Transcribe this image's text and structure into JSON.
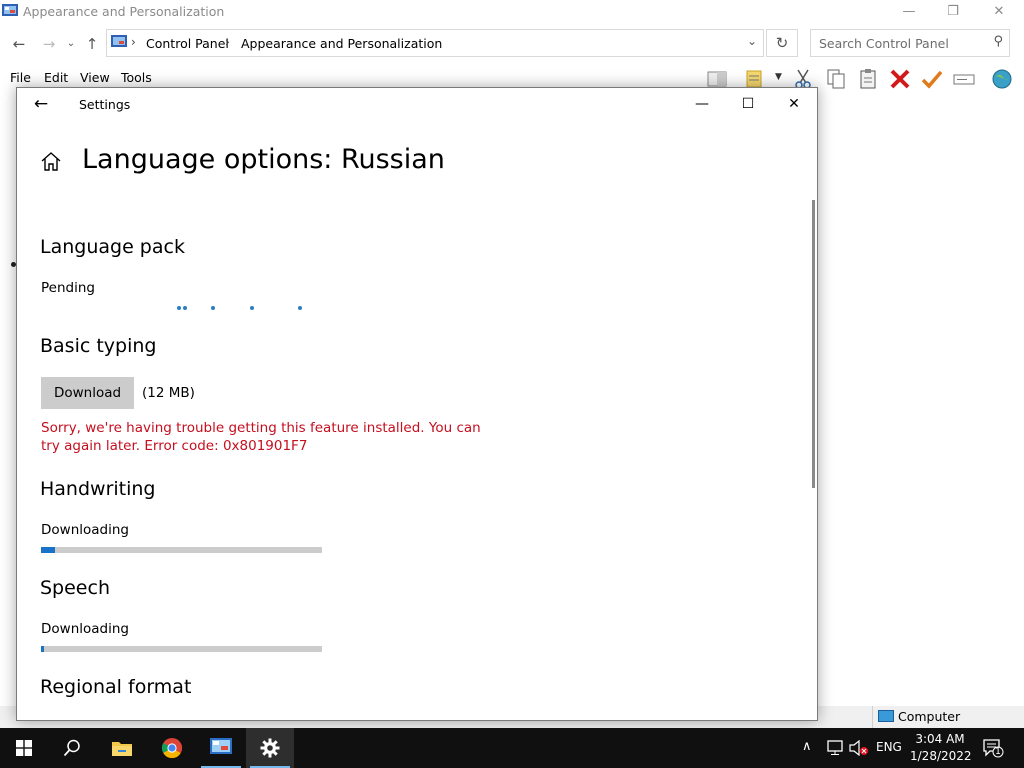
{
  "explorer": {
    "title": "Appearance and Personalization",
    "breadcrumb": [
      "Control Panel",
      "Appearance and Personalization"
    ],
    "search_placeholder": "Search Control Panel",
    "menu": [
      "File",
      "Edit",
      "View",
      "Tools"
    ],
    "status_location": "Computer"
  },
  "settings": {
    "window_title": "Settings",
    "page_title": "Language options: Russian",
    "sections": {
      "language_pack": {
        "heading": "Language pack",
        "status": "Pending"
      },
      "basic_typing": {
        "heading": "Basic typing",
        "button_label": "Download",
        "size": "(12 MB)",
        "error": "Sorry, we're having trouble getting this feature installed. You can try again later. Error code: 0x801901F7"
      },
      "handwriting": {
        "heading": "Handwriting",
        "status": "Downloading",
        "progress": 0.05
      },
      "speech": {
        "heading": "Speech",
        "status": "Downloading",
        "progress": 0.01
      },
      "regional_format": {
        "heading": "Regional format"
      }
    }
  },
  "taskbar": {
    "language": "ENG",
    "time": "3:04 AM",
    "date": "1/28/2022",
    "notification_count": "1"
  },
  "colors": {
    "error": "#c50f1f",
    "accent": "#1a73c7",
    "taskbar": "#101010"
  }
}
